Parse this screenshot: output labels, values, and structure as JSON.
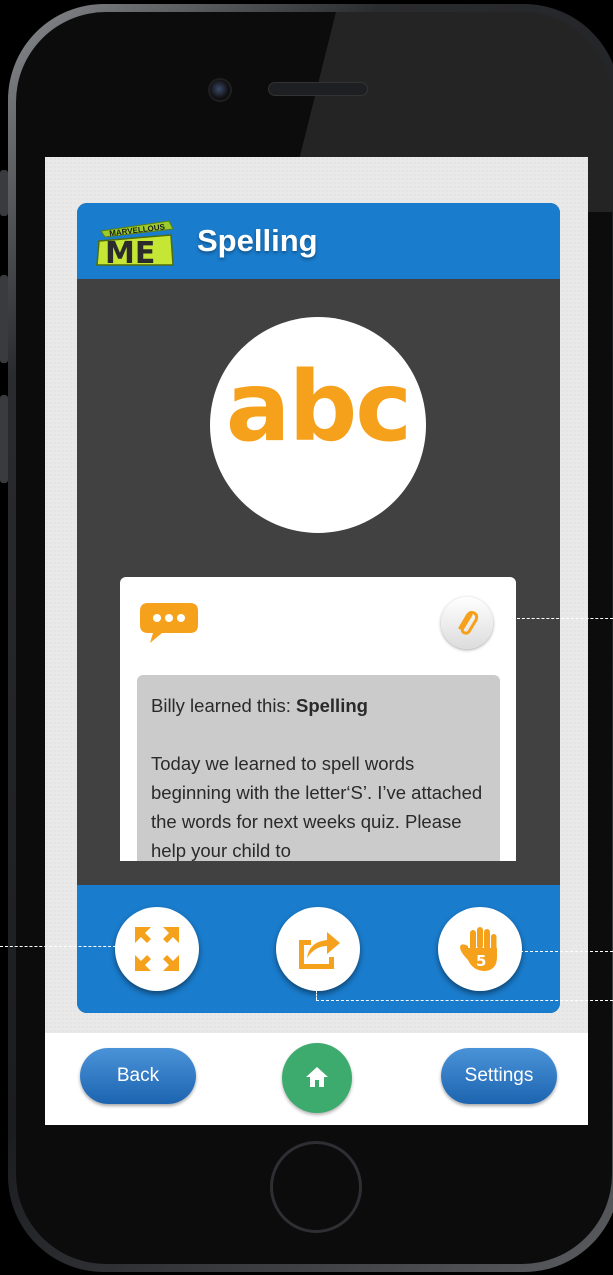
{
  "app": {
    "logo_text_small": "MARVELLOUS",
    "logo_text_large": "ME",
    "title": "Spelling"
  },
  "activity": {
    "icon_text": "abc"
  },
  "note": {
    "heading_prefix": "Billy learned this: ",
    "heading_subject": "Spelling",
    "body": "Today we learned to spell words beginning with the letter‘S’. I’ve attached the words for next weeks quiz. Please help your child to"
  },
  "nav": {
    "back_label": "Back",
    "settings_label": "Settings"
  },
  "colors": {
    "accent_blue": "#1a7ccd",
    "accent_orange": "#f6a11b",
    "panel_dark": "#414141",
    "home_green": "#3daa6e"
  },
  "icons": {
    "chat": "speech-bubble-icon",
    "attach": "paperclip-icon",
    "expand": "expand-arrows-icon",
    "share": "share-arrow-icon",
    "high_five": "high-five-hand-icon",
    "home": "home-icon"
  }
}
